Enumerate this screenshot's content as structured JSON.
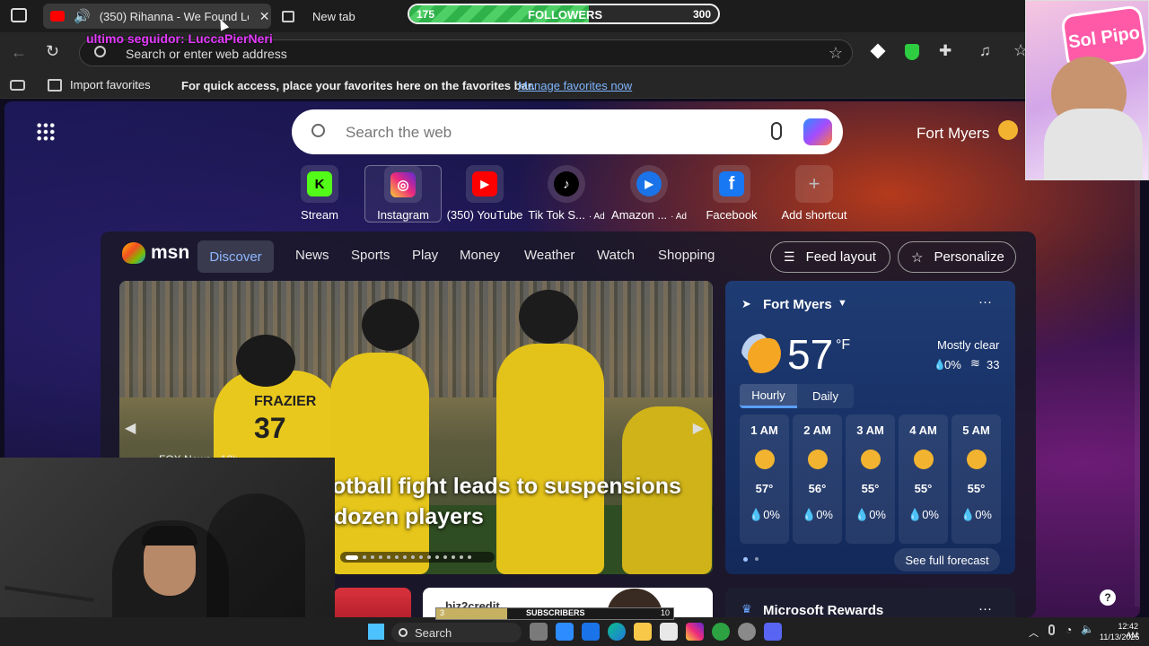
{
  "browser": {
    "tabs": [
      {
        "label": "(350) Rihanna - We Found Lo",
        "active": true
      },
      {
        "label": "New tab",
        "active": false
      }
    ],
    "address_placeholder": "Search or enter web address",
    "favorites": {
      "import_label": "Import favorites",
      "hint": "For quick access, place your favorites here on the favorites bar.",
      "manage_link": "Manage favorites now"
    }
  },
  "stream_overlay": {
    "followers_label": "FOLLOWERS",
    "followers_current": "175",
    "followers_goal": "300",
    "followers_progress": 0.58,
    "last_follower": "ultimo seguidor: LuccaPierNeri",
    "subscribers_label": "SUBSCRIBERS",
    "subscribers_current": "3",
    "subscribers_goal": "10",
    "subscribers_progress": 0.3,
    "corner_art_text": "Sol Pipo"
  },
  "newtab": {
    "search_placeholder": "Search the web",
    "location": "Fort Myers",
    "shortcuts": [
      {
        "label": "Stream",
        "icon": "kick-icon",
        "color": "#53fc18",
        "glyph": "K",
        "ad": ""
      },
      {
        "label": "Instagram",
        "icon": "instagram-icon",
        "color": "#d6249f",
        "glyph": "◎",
        "ad": ""
      },
      {
        "label": "(350) YouTube",
        "icon": "youtube-icon",
        "color": "#ff0000",
        "glyph": "▶",
        "ad": ""
      },
      {
        "label": "Tik Tok S...",
        "icon": "tiktok-icon",
        "color": "#000000",
        "glyph": "♪",
        "ad": "· Ad"
      },
      {
        "label": "Amazon ...",
        "icon": "amazon-icon",
        "color": "#1a73e8",
        "glyph": "▶",
        "ad": "· Ad"
      },
      {
        "label": "Facebook",
        "icon": "facebook-icon",
        "color": "#1877f2",
        "glyph": "f",
        "ad": ""
      },
      {
        "label": "Add shortcut",
        "icon": "plus-icon",
        "color": "#555555",
        "glyph": "+",
        "ad": ""
      }
    ]
  },
  "msn": {
    "logo": "msn",
    "nav": [
      "Discover",
      "News",
      "Sports",
      "Play",
      "Money",
      "Weather",
      "Watch",
      "Shopping"
    ],
    "feed_layout": "Feed layout",
    "personalize": "Personalize",
    "hero": {
      "source": "FOX News · 12h",
      "headline_1": "otball fight leads to suspensions",
      "headline_2": "dozen players",
      "jersey_1": "FRAZIER",
      "jersey_number": "37"
    },
    "weather": {
      "location": "Fort Myers",
      "temp": "57",
      "unit": "°F",
      "condition": "Mostly clear",
      "precip": "0%",
      "wind": "33",
      "tabs": [
        "Hourly",
        "Daily"
      ],
      "hourly": [
        {
          "time": "1 AM",
          "temp": "57°",
          "precip": "0%"
        },
        {
          "time": "2 AM",
          "temp": "56°",
          "precip": "0%"
        },
        {
          "time": "3 AM",
          "temp": "55°",
          "precip": "0%"
        },
        {
          "time": "4 AM",
          "temp": "55°",
          "precip": "0%"
        },
        {
          "time": "5 AM",
          "temp": "55°",
          "precip": "0%"
        }
      ],
      "full_forecast": "See full forecast"
    },
    "rewards": "Microsoft Rewards",
    "ad_brand": "biz2credit"
  },
  "taskbar": {
    "search": "Search",
    "time": "12:42 AM",
    "date": "11/13/2025",
    "help": "?"
  }
}
